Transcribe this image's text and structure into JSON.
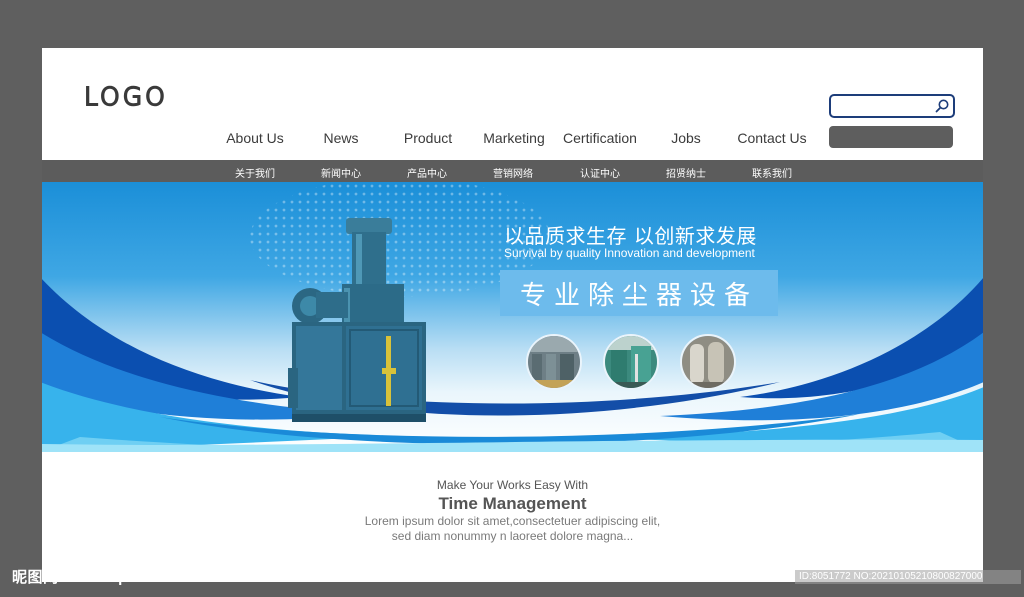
{
  "header": {
    "logo_text": "LOGO",
    "search": {
      "placeholder": ""
    }
  },
  "nav": {
    "items": [
      {
        "label": "About Us"
      },
      {
        "label": "News"
      },
      {
        "label": "Product"
      },
      {
        "label": "Marketing"
      },
      {
        "label": "Certification"
      },
      {
        "label": "Jobs"
      },
      {
        "label": "Contact Us"
      }
    ]
  },
  "subnav": {
    "items": [
      {
        "label": "关于我们"
      },
      {
        "label": "新闻中心"
      },
      {
        "label": "产品中心"
      },
      {
        "label": "营销网络"
      },
      {
        "label": "认证中心"
      },
      {
        "label": "招贤纳士"
      },
      {
        "label": "联系我们"
      }
    ]
  },
  "banner": {
    "slogan_cn": "以品质求生存  以创新求发展",
    "slogan_en": "Survival by quality  Innovation and development",
    "title": "专业除尘器设备"
  },
  "intro": {
    "subtitle": "Make Your Works Easy With",
    "title": "Time Management",
    "line1": "Lorem ipsum dolor sit amet,consectetuer adipiscing elit,",
    "line2": "sed diam nonummy n laoreet dolore magna..."
  },
  "watermark": {
    "left": "昵图网 www.nipic.com",
    "right": "ID:8051772 NO:20210105210800827000"
  },
  "colors": {
    "frame": "#5f5f5f",
    "subbar": "#5c5c5c",
    "banner_blue": "#1b8fd8",
    "search_border": "#1d3d7a",
    "machine_teal": "#2d6f8f"
  }
}
